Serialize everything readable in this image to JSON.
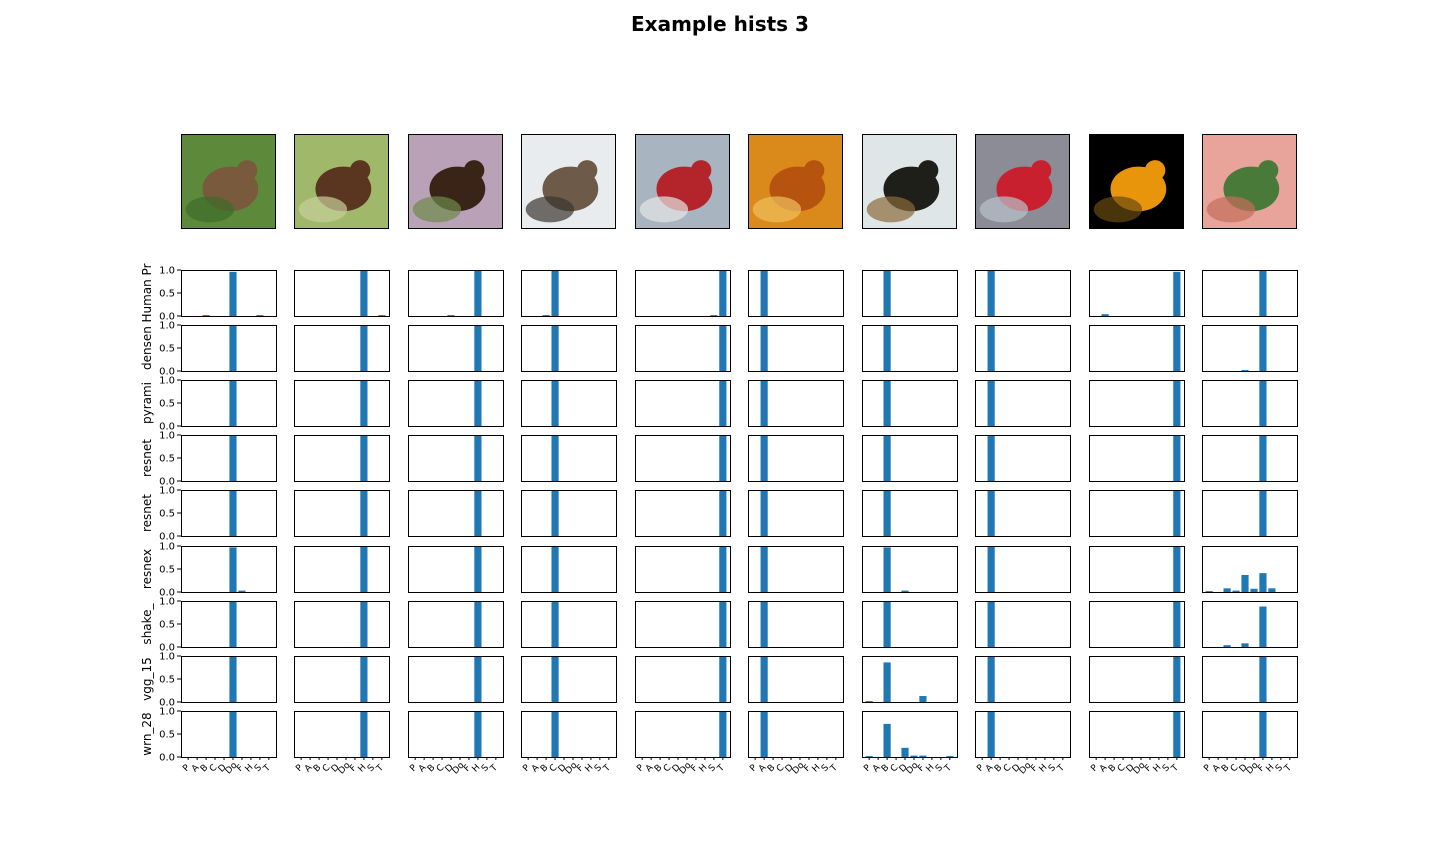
{
  "figure_title": "Example hists 3",
  "bar_color": "#1f77b4",
  "chart_data": {
    "type": "bar",
    "title": "Example hists 3",
    "class_ticks": [
      "P",
      "A",
      "B",
      "C",
      "D",
      "Do",
      "F",
      "H",
      "S",
      "T"
    ],
    "ylim": [
      0,
      1
    ],
    "yticks": [
      "0.0",
      "0.5",
      "1.0"
    ],
    "rows": [
      "Human Pr",
      "densen",
      "pyrami",
      "resnet",
      "resnet",
      "resnex",
      "shake_",
      "vgg_15",
      "wrn_28"
    ],
    "images": [
      {
        "depicts": "dog",
        "palette": [
          "#5c8a3a",
          "#7a5a3c",
          "#3f6b2a"
        ],
        "values": [
          [
            0,
            0,
            0.02,
            0,
            0,
            0.96,
            0,
            0,
            0.02,
            0
          ],
          [
            0,
            0,
            0,
            0,
            0,
            1.0,
            0,
            0,
            0,
            0
          ],
          [
            0,
            0,
            0,
            0,
            0,
            1.0,
            0,
            0,
            0,
            0
          ],
          [
            0,
            0,
            0,
            0,
            0,
            1.0,
            0,
            0,
            0,
            0
          ],
          [
            0,
            0,
            0,
            0,
            0,
            1.0,
            0,
            0,
            0,
            0
          ],
          [
            0,
            0,
            0,
            0,
            0,
            0.97,
            0.03,
            0,
            0,
            0
          ],
          [
            0,
            0,
            0,
            0,
            0,
            1.0,
            0,
            0,
            0,
            0
          ],
          [
            0,
            0,
            0,
            0,
            0,
            1.0,
            0,
            0,
            0,
            0
          ],
          [
            0,
            0,
            0,
            0,
            0,
            1.0,
            0,
            0,
            0,
            0
          ]
        ]
      },
      {
        "depicts": "horse",
        "palette": [
          "#9fb86a",
          "#5a3620",
          "#c7cf9a"
        ],
        "values": [
          [
            0,
            0,
            0,
            0,
            0,
            0,
            0,
            0.98,
            0,
            0.02
          ],
          [
            0,
            0,
            0,
            0,
            0,
            0,
            0,
            1.0,
            0,
            0
          ],
          [
            0,
            0,
            0,
            0,
            0,
            0,
            0,
            1.0,
            0,
            0
          ],
          [
            0,
            0,
            0,
            0,
            0,
            0,
            0,
            1.0,
            0,
            0
          ],
          [
            0,
            0,
            0,
            0,
            0,
            0,
            0,
            1.0,
            0,
            0
          ],
          [
            0,
            0,
            0,
            0,
            0,
            0,
            0,
            1.0,
            0,
            0
          ],
          [
            0,
            0,
            0,
            0,
            0,
            0,
            0,
            1.0,
            0,
            0
          ],
          [
            0,
            0,
            0,
            0,
            0,
            0,
            0,
            1.0,
            0,
            0
          ],
          [
            0,
            0,
            0,
            0,
            0,
            0,
            0,
            1.0,
            0,
            0
          ]
        ]
      },
      {
        "depicts": "horse",
        "palette": [
          "#b9a2b8",
          "#3a2418",
          "#6f8a4a"
        ],
        "values": [
          [
            0,
            0,
            0,
            0,
            0.02,
            0,
            0,
            0.98,
            0,
            0
          ],
          [
            0,
            0,
            0,
            0,
            0,
            0,
            0,
            1.0,
            0,
            0
          ],
          [
            0,
            0,
            0,
            0,
            0,
            0,
            0,
            1.0,
            0,
            0
          ],
          [
            0,
            0,
            0,
            0,
            0,
            0,
            0,
            1.0,
            0,
            0
          ],
          [
            0,
            0,
            0,
            0,
            0,
            0,
            0,
            1.0,
            0,
            0
          ],
          [
            0,
            0,
            0,
            0,
            0,
            0,
            0,
            1.0,
            0,
            0
          ],
          [
            0,
            0,
            0,
            0,
            0,
            0,
            0,
            1.0,
            0,
            0
          ],
          [
            0,
            0,
            0,
            0,
            0,
            0,
            0,
            1.0,
            0,
            0
          ],
          [
            0,
            0,
            0,
            0,
            0,
            0,
            0,
            1.0,
            0,
            0
          ]
        ]
      },
      {
        "depicts": "cat",
        "palette": [
          "#e9ecef",
          "#6d5a48",
          "#3a3530"
        ],
        "values": [
          [
            0,
            0,
            0.02,
            0.98,
            0,
            0,
            0,
            0,
            0,
            0
          ],
          [
            0,
            0,
            0,
            1.0,
            0,
            0,
            0,
            0,
            0,
            0
          ],
          [
            0,
            0,
            0,
            1.0,
            0,
            0,
            0,
            0,
            0,
            0
          ],
          [
            0,
            0,
            0,
            1.0,
            0,
            0,
            0,
            0,
            0,
            0
          ],
          [
            0,
            0,
            0,
            1.0,
            0,
            0,
            0,
            0,
            0,
            0
          ],
          [
            0,
            0,
            0,
            1.0,
            0,
            0,
            0,
            0,
            0,
            0
          ],
          [
            0,
            0,
            0,
            1.0,
            0,
            0,
            0,
            0,
            0,
            0
          ],
          [
            0,
            0,
            0,
            1.0,
            0,
            0,
            0,
            0,
            0,
            0
          ],
          [
            0,
            0,
            0,
            1.0,
            0,
            0,
            0,
            0,
            0,
            0
          ]
        ]
      },
      {
        "depicts": "fire truck",
        "palette": [
          "#a8b4c0",
          "#b3242b",
          "#e6e6e6"
        ],
        "values": [
          [
            0,
            0,
            0,
            0,
            0,
            0,
            0,
            0,
            0.02,
            0.98
          ],
          [
            0,
            0,
            0,
            0,
            0,
            0,
            0,
            0,
            0,
            1.0
          ],
          [
            0,
            0,
            0,
            0,
            0,
            0,
            0,
            0,
            0,
            1.0
          ],
          [
            0,
            0,
            0,
            0,
            0,
            0,
            0,
            0,
            0,
            1.0
          ],
          [
            0,
            0,
            0,
            0,
            0,
            0,
            0,
            0,
            0,
            1.0
          ],
          [
            0,
            0,
            0,
            0,
            0,
            0,
            0,
            0,
            0,
            1.0
          ],
          [
            0,
            0,
            0,
            0,
            0,
            0,
            0,
            0,
            0,
            1.0
          ],
          [
            0,
            0,
            0,
            0,
            0,
            0,
            0,
            0,
            0,
            1.0
          ],
          [
            0,
            0,
            0,
            0,
            0,
            0,
            0,
            0,
            0,
            1.0
          ]
        ]
      },
      {
        "depicts": "car",
        "palette": [
          "#d98a1a",
          "#b5530f",
          "#f0c060"
        ],
        "values": [
          [
            0,
            1.0,
            0,
            0,
            0,
            0,
            0,
            0,
            0,
            0
          ],
          [
            0,
            1.0,
            0,
            0,
            0,
            0,
            0,
            0,
            0,
            0
          ],
          [
            0,
            1.0,
            0,
            0,
            0,
            0,
            0,
            0,
            0,
            0
          ],
          [
            0,
            1.0,
            0,
            0,
            0,
            0,
            0,
            0,
            0,
            0
          ],
          [
            0,
            1.0,
            0,
            0,
            0,
            0,
            0,
            0,
            0,
            0
          ],
          [
            0,
            1.0,
            0,
            0,
            0,
            0,
            0,
            0,
            0,
            0
          ],
          [
            0,
            1.0,
            0,
            0,
            0,
            0,
            0,
            0,
            0,
            0
          ],
          [
            0,
            1.0,
            0,
            0,
            0,
            0,
            0,
            0,
            0,
            0
          ],
          [
            0,
            1.0,
            0,
            0,
            0,
            0,
            0,
            0,
            0,
            0
          ]
        ]
      },
      {
        "depicts": "bird",
        "palette": [
          "#dfe6e8",
          "#1f1f1a",
          "#8a6a3a"
        ],
        "values": [
          [
            0,
            0,
            1.0,
            0,
            0,
            0,
            0,
            0,
            0,
            0
          ],
          [
            0,
            0,
            1.0,
            0,
            0,
            0,
            0,
            0,
            0,
            0
          ],
          [
            0,
            0,
            1.0,
            0,
            0,
            0,
            0,
            0,
            0,
            0
          ],
          [
            0,
            0,
            1.0,
            0,
            0,
            0,
            0,
            0,
            0,
            0
          ],
          [
            0,
            0,
            1.0,
            0,
            0,
            0,
            0,
            0,
            0,
            0
          ],
          [
            0,
            0,
            0.97,
            0,
            0.03,
            0,
            0,
            0,
            0,
            0
          ],
          [
            0,
            0,
            1.0,
            0,
            0,
            0,
            0,
            0,
            0,
            0
          ],
          [
            0.02,
            0,
            0.86,
            0,
            0,
            0,
            0.13,
            0,
            0,
            0
          ],
          [
            0.02,
            0,
            0.72,
            0,
            0.2,
            0.03,
            0.03,
            0,
            0,
            0.02
          ]
        ]
      },
      {
        "depicts": "car",
        "palette": [
          "#8c8c96",
          "#c8202e",
          "#b9c2cc"
        ],
        "values": [
          [
            0,
            1.0,
            0,
            0,
            0,
            0,
            0,
            0,
            0,
            0
          ],
          [
            0,
            1.0,
            0,
            0,
            0,
            0,
            0,
            0,
            0,
            0
          ],
          [
            0,
            1.0,
            0,
            0,
            0,
            0,
            0,
            0,
            0,
            0
          ],
          [
            0,
            1.0,
            0,
            0,
            0,
            0,
            0,
            0,
            0,
            0
          ],
          [
            0,
            1.0,
            0,
            0,
            0,
            0,
            0,
            0,
            0,
            0
          ],
          [
            0,
            1.0,
            0,
            0,
            0,
            0,
            0,
            0,
            0,
            0
          ],
          [
            0,
            1.0,
            0,
            0,
            0,
            0,
            0,
            0,
            0,
            0
          ],
          [
            0,
            1.0,
            0,
            0,
            0,
            0,
            0,
            0,
            0,
            0
          ],
          [
            0,
            1.0,
            0,
            0,
            0,
            0,
            0,
            0,
            0,
            0
          ]
        ]
      },
      {
        "depicts": "truck",
        "palette": [
          "#000000",
          "#e8950c",
          "#6a4a10"
        ],
        "values": [
          [
            0,
            0.04,
            0,
            0,
            0,
            0,
            0,
            0,
            0,
            0.96
          ],
          [
            0,
            0,
            0,
            0,
            0,
            0,
            0,
            0,
            0,
            1.0
          ],
          [
            0,
            0,
            0,
            0,
            0,
            0,
            0,
            0,
            0,
            1.0
          ],
          [
            0,
            0,
            0,
            0,
            0,
            0,
            0,
            0,
            0,
            1.0
          ],
          [
            0,
            0,
            0,
            0,
            0,
            0,
            0,
            0,
            0,
            1.0
          ],
          [
            0,
            0,
            0,
            0,
            0,
            0,
            0,
            0,
            0,
            1.0
          ],
          [
            0,
            0,
            0,
            0,
            0,
            0,
            0,
            0,
            0,
            1.0
          ],
          [
            0,
            0,
            0,
            0,
            0,
            0,
            0,
            0,
            0,
            1.0
          ],
          [
            0,
            0,
            0,
            0,
            0,
            0,
            0,
            0,
            0,
            1.0
          ]
        ]
      },
      {
        "depicts": "frog",
        "palette": [
          "#e8a49a",
          "#4a7a3a",
          "#c46c5a"
        ],
        "values": [
          [
            0,
            0,
            0,
            0,
            0,
            0,
            1.0,
            0,
            0,
            0
          ],
          [
            0,
            0,
            0,
            0,
            0.02,
            0,
            1.0,
            0,
            0,
            0
          ],
          [
            0,
            0,
            0,
            0,
            0,
            0,
            1.0,
            0,
            0,
            0
          ],
          [
            0,
            0,
            0,
            0,
            0,
            0,
            1.0,
            0,
            0,
            0
          ],
          [
            0,
            0,
            0,
            0,
            0,
            0,
            1.0,
            0,
            0,
            0
          ],
          [
            0.02,
            0,
            0.08,
            0.03,
            0.37,
            0.07,
            0.41,
            0.08,
            0,
            0
          ],
          [
            0,
            0,
            0.04,
            0,
            0.08,
            0,
            0.88,
            0,
            0,
            0
          ],
          [
            0,
            0,
            0,
            0,
            0,
            0,
            1.0,
            0,
            0,
            0
          ],
          [
            0,
            0,
            0,
            0,
            0,
            0,
            1.0,
            0,
            0,
            0
          ]
        ]
      }
    ]
  }
}
